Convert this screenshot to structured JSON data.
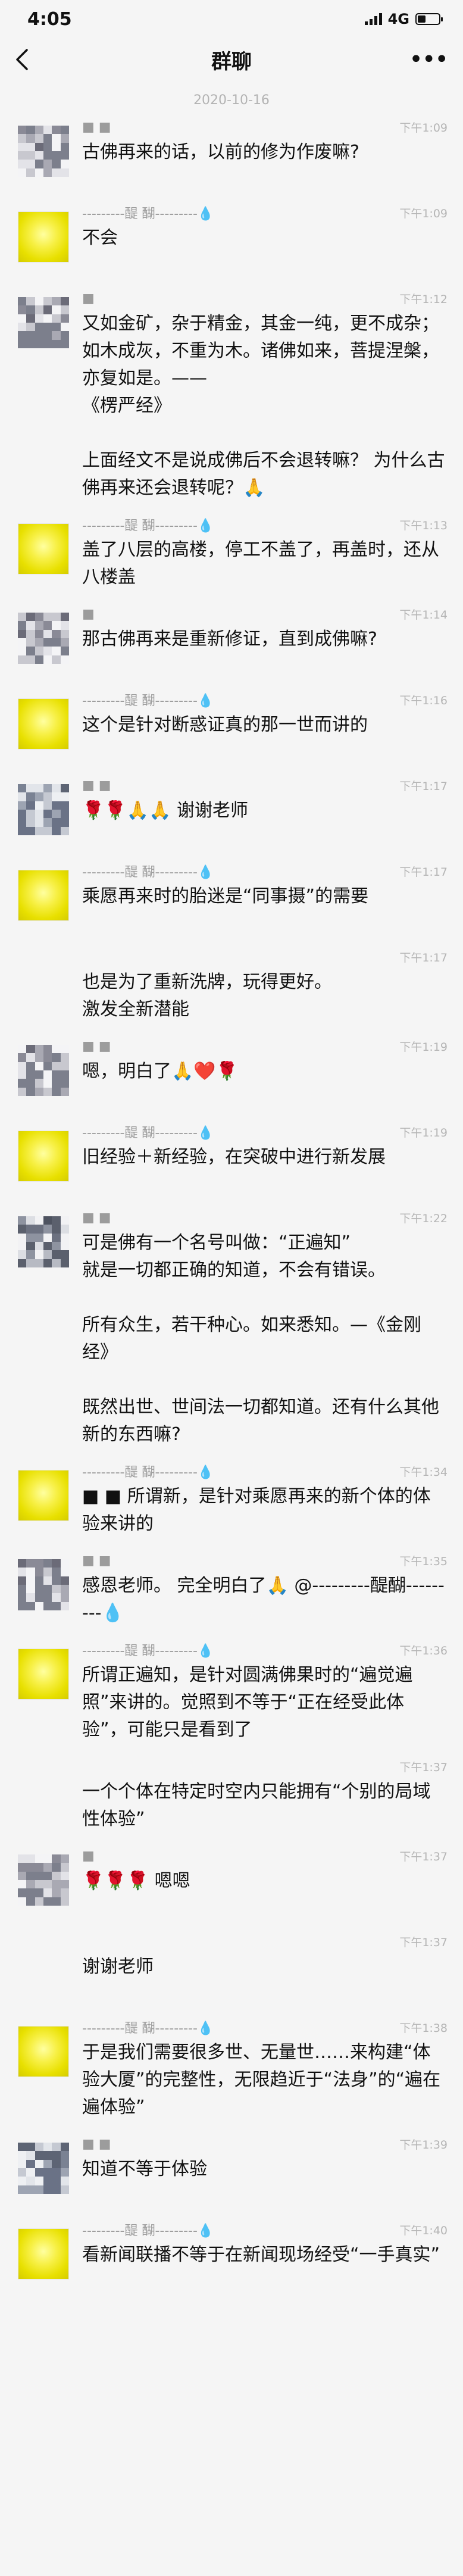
{
  "status": {
    "time": "4:05",
    "network": "4G",
    "battery_level": 0.35
  },
  "nav": {
    "title": "群聊"
  },
  "date": "2020-10-16",
  "messages": [
    {
      "sender": "■ ■",
      "avatar": "blur-gray",
      "time": "下午1:09",
      "text": "古佛再来的话，以前的修为作废嘛?"
    },
    {
      "sender": "---------醍 醐---------💧",
      "avatar": "yellow",
      "time": "下午1:09",
      "text": "不会"
    },
    {
      "sender": "■",
      "avatar": "blur-gray",
      "time": "下午1:12",
      "text": "又如金矿，杂于精金，其金一纯，更不成杂；如木成灰，不重为木。诸佛如来，菩提涅槃，亦复如是。——\n《楞严经》\n\n上面经文不是说成佛后不会退转嘛？ 为什么古佛再来还会退转呢？🙏"
    },
    {
      "sender": "---------醍 醐---------💧",
      "avatar": "yellow",
      "time": "下午1:13",
      "text": "盖了八层的高楼，停工不盖了，再盖时，还从八楼盖"
    },
    {
      "sender": "■",
      "avatar": "blur-gray",
      "time": "下午1:14",
      "text": "那古佛再来是重新修证，直到成佛嘛?"
    },
    {
      "sender": "---------醍 醐---------💧",
      "avatar": "yellow",
      "time": "下午1:16",
      "text": "这个是针对断惑证真的那一世而讲的"
    },
    {
      "sender": "■ ■",
      "avatar": "blur-blue",
      "time": "下午1:17",
      "text": "🌹🌹🙏🙏 谢谢老师"
    },
    {
      "sender": "---------醍 醐---------💧",
      "avatar": "yellow",
      "time": "下午1:17",
      "text": "乘愿再来时的胎迷是“同事摄”的需要"
    },
    {
      "sender": "",
      "avatar": "none",
      "time": "下午1:17",
      "text": "也是为了重新洗牌，玩得更好。\n激发全新潜能"
    },
    {
      "sender": "■ ■",
      "avatar": "blur-gray",
      "time": "下午1:19",
      "text": "嗯，明白了🙏❤️🌹"
    },
    {
      "sender": "---------醍 醐---------💧",
      "avatar": "yellow",
      "time": "下午1:19",
      "text": "旧经验＋新经验，在突破中进行新发展"
    },
    {
      "sender": "■ ■",
      "avatar": "blur-dark",
      "time": "下午1:22",
      "text": "可是佛有一个名号叫做：“正遍知”\n就是一切都正确的知道，不会有错误。\n\n所有众生，若干种心。如来悉知。—《金刚经》\n\n既然出世、世间法一切都知道。还有什么其他新的东西嘛?"
    },
    {
      "sender": "---------醍 醐---------💧",
      "avatar": "yellow",
      "time": "下午1:34",
      "text": "■ ■ 所谓新，是针对乘愿再来的新个体的体验来讲的"
    },
    {
      "sender": "■ ■",
      "avatar": "blur-gray",
      "time": "下午1:35",
      "text": "感恩老师。 完全明白了🙏 @---------醍醐---------💧"
    },
    {
      "sender": "---------醍 醐---------💧",
      "avatar": "yellow",
      "time": "下午1:36",
      "text": "所谓正遍知，是针对圆满佛果时的“遍觉遍照”来讲的。觉照到不等于“正在经受此体验”，可能只是看到了"
    },
    {
      "sender": "",
      "avatar": "none",
      "time": "下午1:37",
      "text": "一个个体在特定时空内只能拥有“个别的局域性体验”"
    },
    {
      "sender": "■",
      "avatar": "blur-gray",
      "time": "下午1:37",
      "text": "🌹🌹🌹 嗯嗯"
    },
    {
      "sender": "",
      "avatar": "none",
      "time": "下午1:37",
      "text": "谢谢老师"
    },
    {
      "sender": "---------醍 醐---------💧",
      "avatar": "yellow",
      "time": "下午1:38",
      "text": "于是我们需要很多世、无量世……来构建“体验大厦”的完整性，无限趋近于“法身”的“遍在遍体验”"
    },
    {
      "sender": "■ ■",
      "avatar": "blur-blue",
      "time": "下午1:39",
      "text": "知道不等于体验"
    },
    {
      "sender": "---------醍 醐---------💧",
      "avatar": "yellow",
      "time": "下午1:40",
      "text": "看新闻联播不等于在新闻现场经受“一手真实”"
    }
  ]
}
